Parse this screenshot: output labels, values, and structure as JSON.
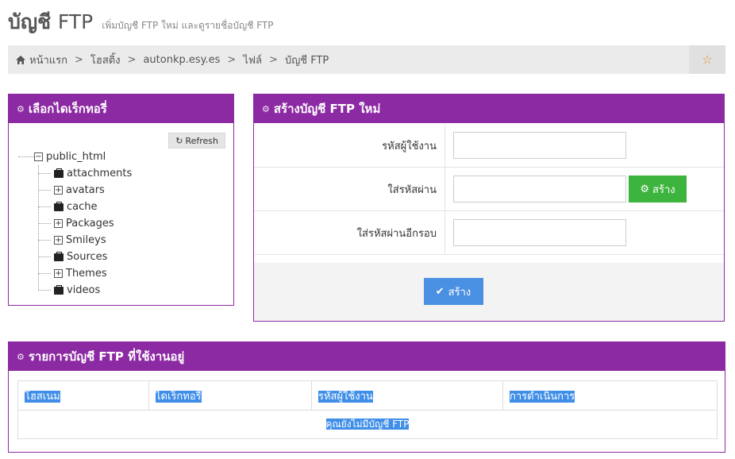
{
  "header": {
    "title_main": "บัญชี",
    "title_suffix": "FTP",
    "subtitle": "เพิ่มบัญชี FTP ใหม่ และดูรายชื่อบัญชี FTP"
  },
  "breadcrumb": {
    "items": [
      "หน้าแรก",
      "โฮสติ้ง",
      "autonkp.esy.es",
      "ไฟล์",
      "บัญชี FTP"
    ],
    "separator": ">"
  },
  "directory_panel": {
    "title": "เลือกไดเร็กทอรี่",
    "refresh_label": "Refresh",
    "root": "public_html",
    "children": [
      {
        "name": "attachments",
        "expandable": false
      },
      {
        "name": "avatars",
        "expandable": true
      },
      {
        "name": "cache",
        "expandable": false
      },
      {
        "name": "Packages",
        "expandable": true
      },
      {
        "name": "Smileys",
        "expandable": true
      },
      {
        "name": "Sources",
        "expandable": false
      },
      {
        "name": "Themes",
        "expandable": true
      },
      {
        "name": "videos",
        "expandable": false
      }
    ]
  },
  "create_panel": {
    "title": "สร้างบัญชี FTP ใหม่",
    "username_label": "รหัสผู้ใช้งาน",
    "password_label": "ใส่รหัสผ่าน",
    "confirm_label": "ใส่รหัสผ่านอีกรอบ",
    "generate_label": "สร้าง",
    "submit_label": "สร้าง",
    "username_value": "",
    "password_value": "",
    "confirm_value": ""
  },
  "list_panel": {
    "title": "รายการบัญชี FTP ที่ใช้งานอยู่",
    "columns": [
      "โฮสเนม",
      "ไดเร็กทอรี่",
      "รหัสผู้ใช้งาน",
      "การดำเนินการ"
    ],
    "empty_message": "คุณยังไม่มีบัญชี FTP"
  },
  "colors": {
    "panel_accent": "#8c2aa3",
    "generate_button": "#3db43d",
    "submit_button": "#4a90e2",
    "favorite_star": "#f0932b"
  }
}
